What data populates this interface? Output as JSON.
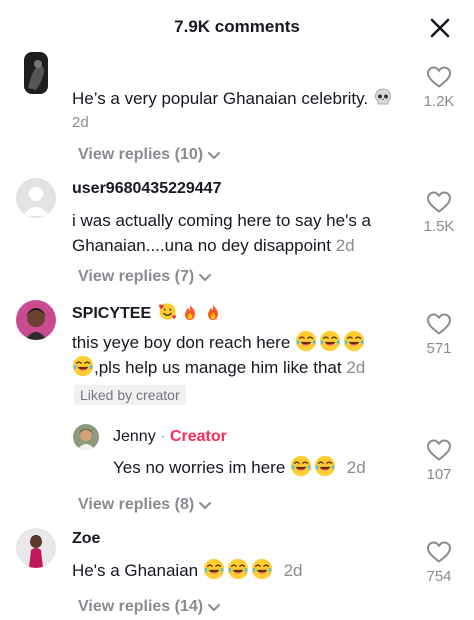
{
  "header": {
    "title": "7.9K comments"
  },
  "comments": [
    {
      "username": "",
      "text": "He’s a very popular Ghanaian celebrity.",
      "emoji": "skull",
      "time": "2d",
      "likes": "1.2K",
      "view_replies": "View replies (10)"
    },
    {
      "username": "user9680435229447",
      "text_line1": "i was actually coming here to say he's a",
      "text_line2": "Ghanaian....una no dey disappoint",
      "time": "2d",
      "likes": "1.5K",
      "view_replies": "View replies (7)"
    },
    {
      "username": "SPICYTEE",
      "text_line1": "this yeye boy don reach here",
      "text_line2": ",pls help us manage him like that",
      "time": "2d",
      "likes": "571",
      "badge": "Liked by creator",
      "reply": {
        "username": "Jenny",
        "separator": "·",
        "role": "Creator",
        "text": "Yes no worries im here",
        "time": "2d",
        "likes": "107"
      },
      "view_replies": "View replies (8)"
    },
    {
      "username": "Zoe",
      "text": "He's a Ghanaian",
      "time": "2d",
      "likes": "754",
      "view_replies": "View replies (14)"
    }
  ],
  "colors": {
    "accent": "#fe2c55",
    "muted": "#8a8b91",
    "text": "#161823"
  },
  "icons": [
    "close-icon",
    "heart-outline-icon",
    "chevron-down-icon",
    "skull-emoji",
    "laughing-emoji",
    "fire-emoji",
    "smiling-hearts-emoji"
  ]
}
